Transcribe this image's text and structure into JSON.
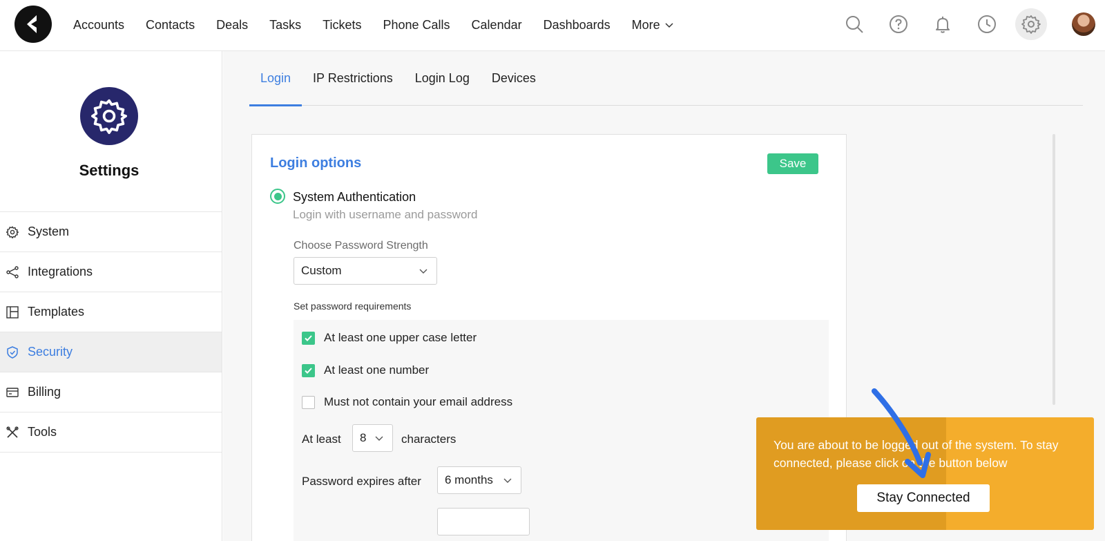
{
  "nav": {
    "logo_icon": "brand-logo-icon",
    "items": [
      "Accounts",
      "Contacts",
      "Deals",
      "Tasks",
      "Tickets",
      "Phone Calls",
      "Calendar",
      "Dashboards",
      "More"
    ],
    "icons": [
      "search-icon",
      "help-icon",
      "bell-icon",
      "clock-icon",
      "gear-icon",
      "avatar"
    ]
  },
  "sidebar": {
    "title": "Settings",
    "items": [
      {
        "label": "System",
        "icon": "gear-icon"
      },
      {
        "label": "Integrations",
        "icon": "share-icon"
      },
      {
        "label": "Templates",
        "icon": "layout-icon"
      },
      {
        "label": "Security",
        "icon": "shield-icon",
        "active": true
      },
      {
        "label": "Billing",
        "icon": "card-icon"
      },
      {
        "label": "Tools",
        "icon": "tools-icon"
      }
    ]
  },
  "tabs": [
    "Login",
    "IP Restrictions",
    "Login Log",
    "Devices"
  ],
  "active_tab": "Login",
  "login_options": {
    "title": "Login options",
    "save_label": "Save",
    "auth_label": "System Authentication",
    "auth_sub": "Login with username and password",
    "strength_label": "Choose Password Strength",
    "strength_value": "Custom",
    "requirements_label": "Set password requirements",
    "requirements": [
      {
        "label": "At least one upper case letter",
        "checked": true
      },
      {
        "label": "At least one number",
        "checked": true
      },
      {
        "label": "Must not contain your email address",
        "checked": false
      }
    ],
    "min_length_prefix": "At least",
    "min_length_value": "8",
    "min_length_suffix": "characters",
    "expires_label": "Password expires after",
    "expires_value": "6 months"
  },
  "toast": {
    "message": "You are about to be logged out of the system. To stay connected, please click on the button below",
    "button_label": "Stay Connected"
  },
  "colors": {
    "accent": "#3d7ee0",
    "success": "#3cc68a",
    "settings_icon_bg": "#27276b",
    "toast_bg": "#f4ad2c",
    "arrow": "#2f6fe6"
  }
}
